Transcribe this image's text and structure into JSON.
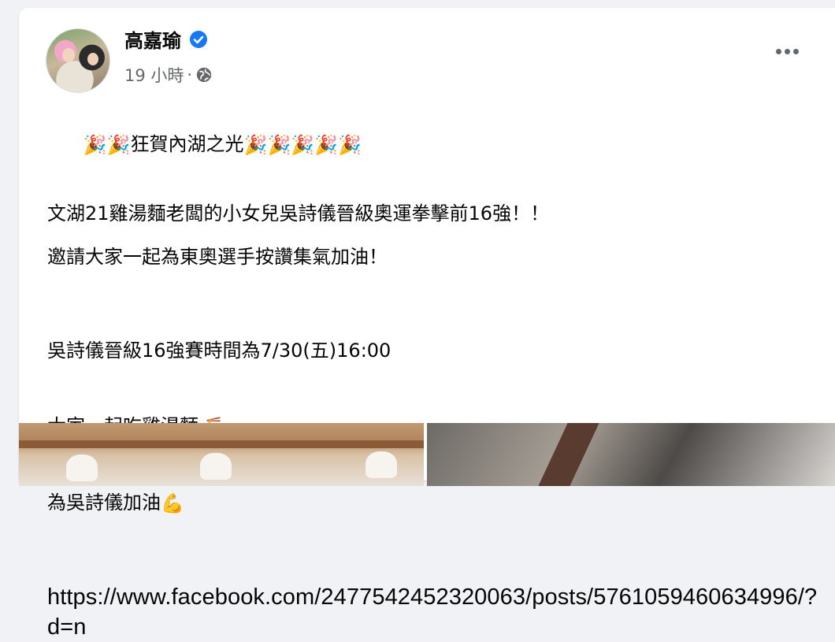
{
  "post": {
    "author": "高嘉瑜",
    "time": "19 小時",
    "separator": "·",
    "paragraphs": {
      "p1": "狂賀內湖之光",
      "p2": "文湖21雞湯麵老闆的小女兒吳詩儀晉級奧運拳擊前16強！！",
      "p3": "邀請大家一起為東奧選手按讚集氣加油！",
      "p4_line1": "吳詩儀晉級16強賽時間為7/30(五)16:00",
      "p4_line2": "大家一起吃雞湯麵",
      "p4_line3": "為吳詩儀加油",
      "link": "https://www.facebook.com/2477542452320063/posts/5761059460634996/?d=n"
    },
    "emojis": {
      "party_popper": "🎉",
      "noodle_bowl": "🍜",
      "flexed_biceps": "💪"
    }
  },
  "icons": {
    "verified": "verified-badge-icon",
    "privacy": "globe-icon",
    "more": "more-options-icon"
  },
  "colors": {
    "verified_blue": "#1877f2",
    "meta_gray": "#65676b",
    "background": "#f0f2f5"
  }
}
